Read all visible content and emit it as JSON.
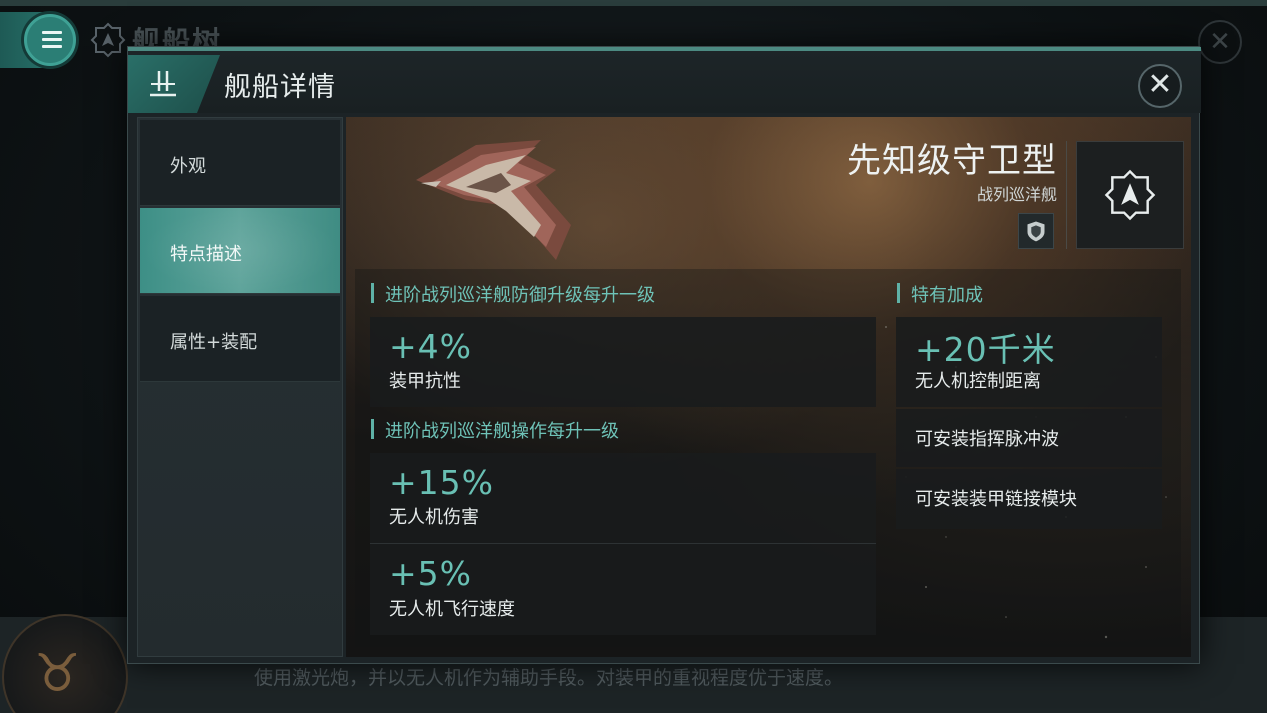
{
  "background": {
    "title": "舰船树",
    "description": "使用激光炮，并以无人机作为辅助手段。对装甲的重视程度优于速度。"
  },
  "modal": {
    "title": "舰船详情",
    "close_icon": "close-icon"
  },
  "sidebar": {
    "items": [
      {
        "label": "外观",
        "active": false
      },
      {
        "label": "特点描述",
        "active": true
      },
      {
        "label": "属性+装配",
        "active": false
      }
    ]
  },
  "ship": {
    "name": "先知级守卫型",
    "class": "战列巡洋舰"
  },
  "sections": {
    "defense": {
      "heading": "进阶战列巡洋舰防御升级每升一级",
      "bonuses": [
        {
          "value": "+4%",
          "label": "装甲抗性"
        }
      ]
    },
    "operation": {
      "heading": "进阶战列巡洋舰操作每升一级",
      "bonuses": [
        {
          "value": "+15%",
          "label": "无人机伤害"
        },
        {
          "value": "+5%",
          "label": "无人机飞行速度"
        }
      ]
    },
    "special": {
      "heading": "特有加成",
      "bonuses": [
        {
          "value": "+20千米",
          "label": "无人机控制距离"
        },
        {
          "value": "",
          "label": "可安装指挥脉冲波"
        },
        {
          "value": "",
          "label": "可安装装甲链接模块"
        }
      ]
    }
  },
  "colors": {
    "accent": "#69c0b4",
    "active_tab": "#4f9d94",
    "panel_bg": "#1c2326"
  }
}
